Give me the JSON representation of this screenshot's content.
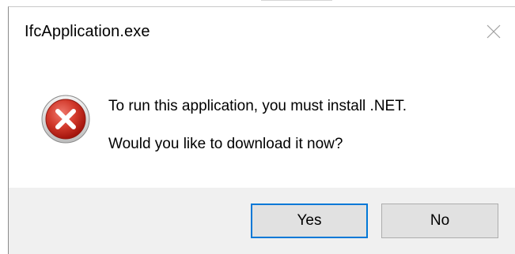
{
  "window": {
    "title": "IfcApplication.exe",
    "close_icon": "close-icon"
  },
  "message": {
    "icon": "error-icon",
    "line1": "To run this application, you must install .NET.",
    "line2": "Would you like to download it now?"
  },
  "buttons": {
    "yes_label": "Yes",
    "no_label": "No"
  },
  "colors": {
    "footer_bg": "#f0f0f0",
    "button_bg": "#e1e1e1",
    "default_button_border": "#0078d7",
    "error_red": "#c5281c"
  }
}
